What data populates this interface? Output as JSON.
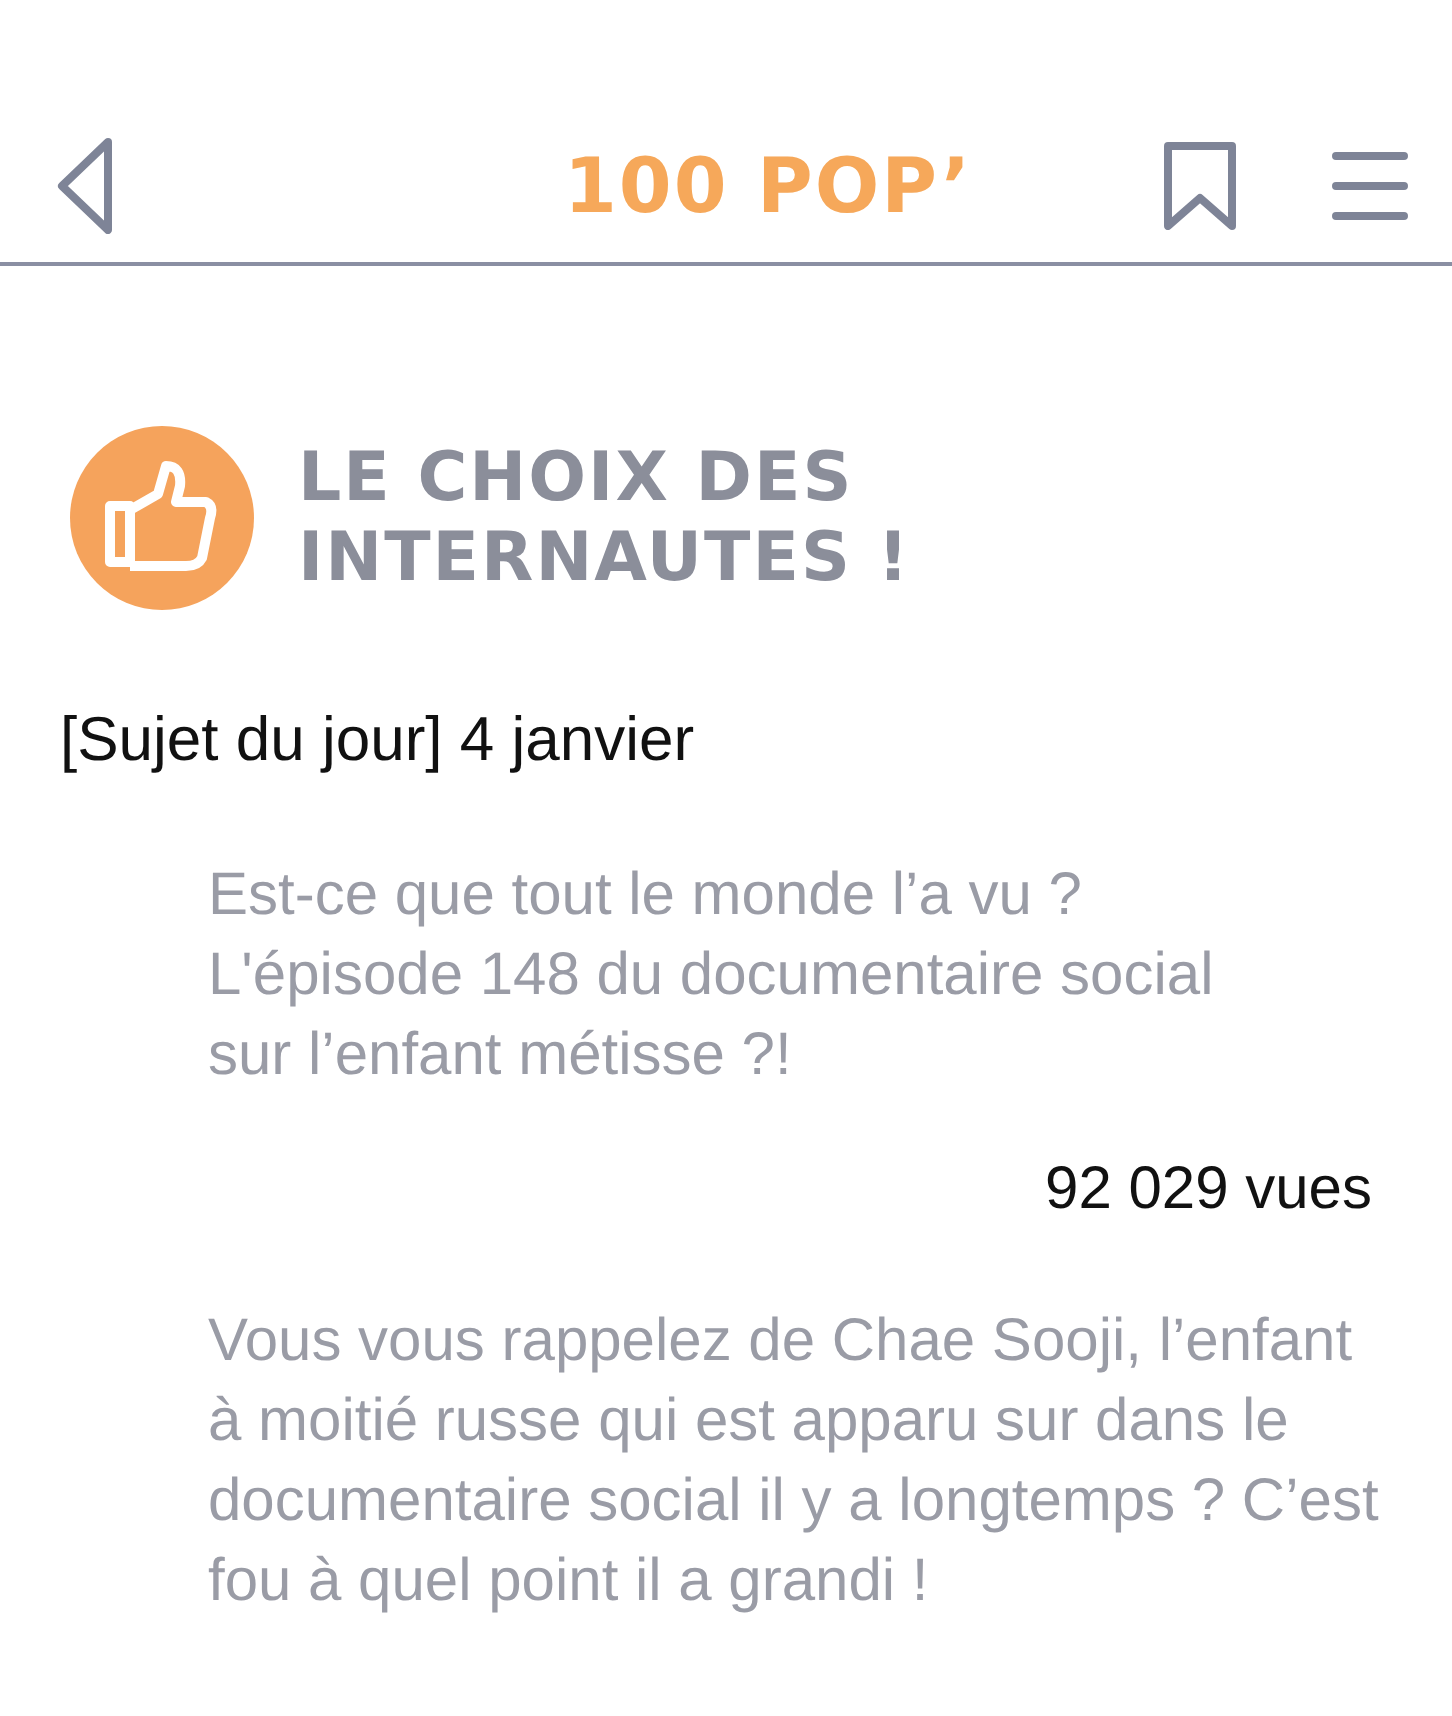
{
  "header": {
    "title": "100 POP’"
  },
  "section": {
    "title": "LE CHOIX DES INTERNAUTES !"
  },
  "topic": "[Sujet du jour] 4 janvier",
  "post": {
    "title": "Est-ce que tout le monde l’a vu ? L'épisode 148 du documentaire social sur l’enfant métisse ?!",
    "views": "92 029 vues",
    "body": "Vous vous rappelez de Chae Sooji, l’enfant à moitié russe qui est apparu sur dans le documentaire social il y a longtemps ? C’est fou à quel point il a grandi !"
  }
}
